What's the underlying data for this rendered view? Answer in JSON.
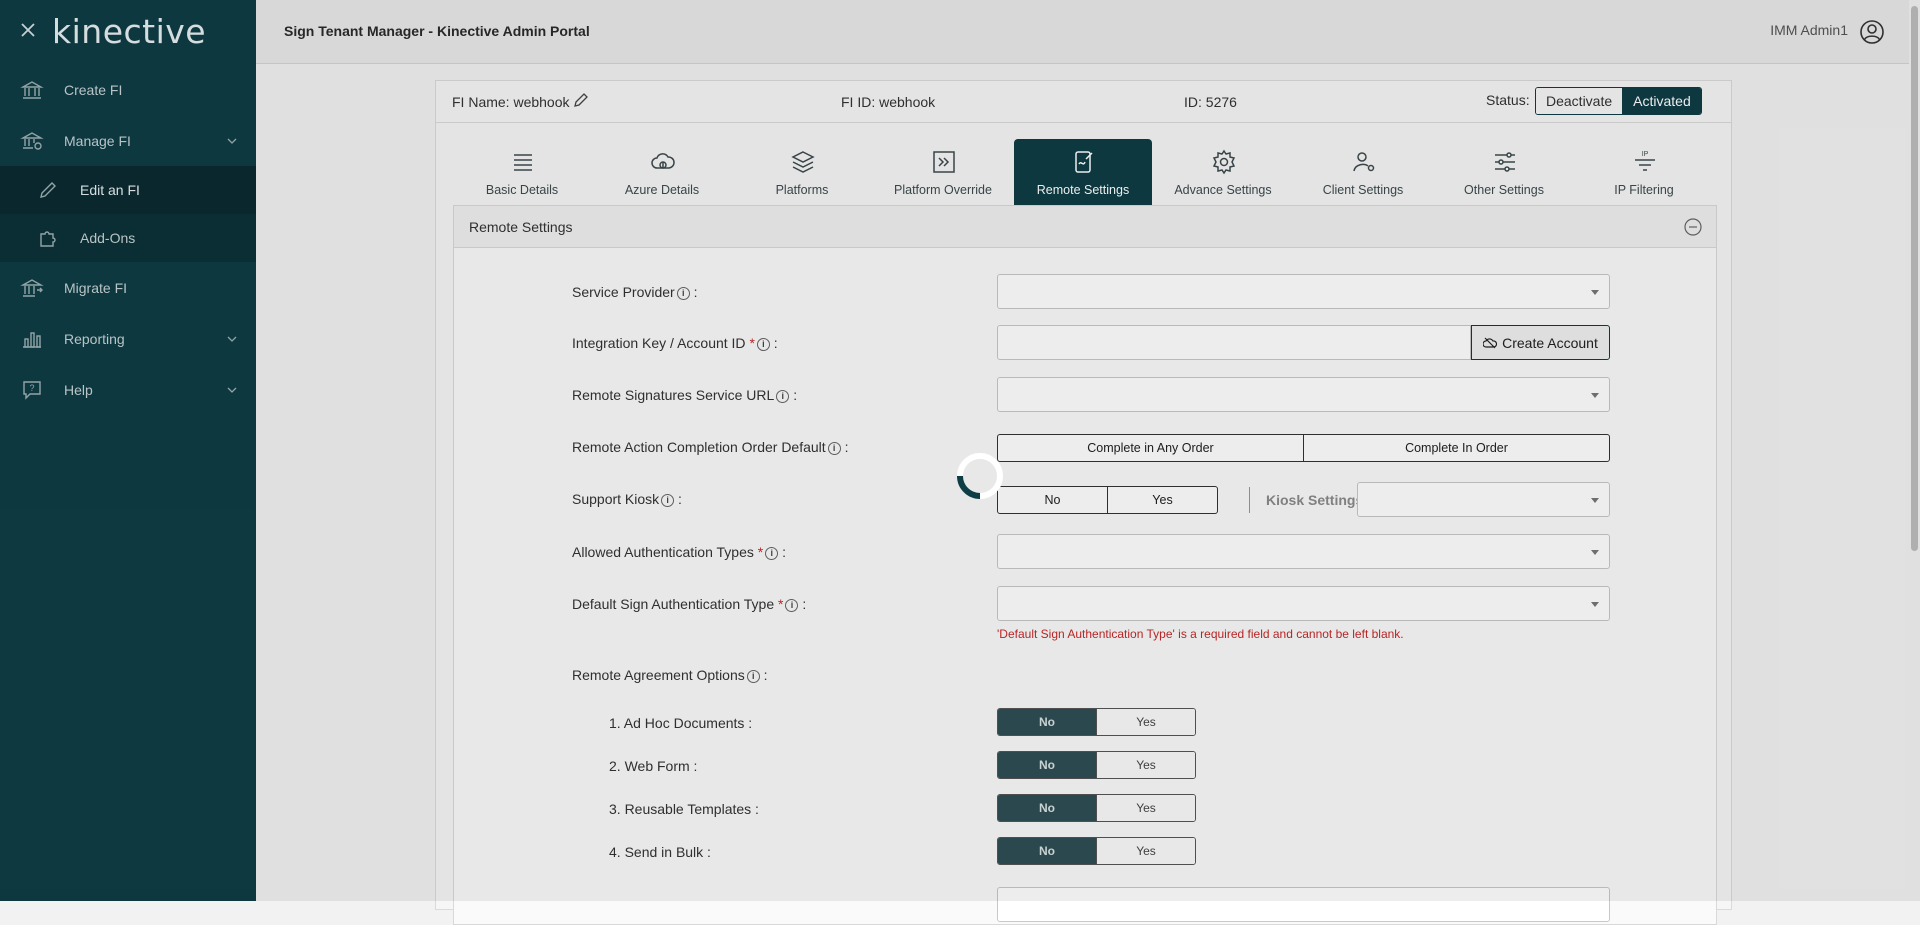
{
  "sidebar": {
    "logo": "kinective",
    "items": [
      {
        "label": "Create FI",
        "icon": "bank-icon"
      },
      {
        "label": "Manage FI",
        "icon": "bank-gear-icon"
      },
      {
        "label": "Edit an FI",
        "icon": "pencil-icon"
      },
      {
        "label": "Add-Ons",
        "icon": "puzzle-icon"
      },
      {
        "label": "Migrate FI",
        "icon": "bank-arrow-icon"
      },
      {
        "label": "Reporting",
        "icon": "bar-chart-icon"
      },
      {
        "label": "Help",
        "icon": "help-bubble-icon"
      }
    ]
  },
  "header": {
    "title": "Sign Tenant Manager - Kinective Admin Portal",
    "user": "IMM Admin1"
  },
  "fi": {
    "name": "FI Name: webhook",
    "fi_id": "FI ID: webhook",
    "id": "ID: 5276",
    "status_label": "Status:",
    "deactivate": "Deactivate",
    "activated": "Activated"
  },
  "tabs": [
    {
      "label": "Basic Details",
      "icon": "list-icon"
    },
    {
      "label": "Azure Details",
      "icon": "cloud-icon"
    },
    {
      "label": "Platforms",
      "icon": "layers-icon"
    },
    {
      "label": "Platform Override",
      "icon": "override-icon"
    },
    {
      "label": "Remote Settings",
      "icon": "remote-sign-icon"
    },
    {
      "label": "Advance Settings",
      "icon": "gear-icon"
    },
    {
      "label": "Client Settings",
      "icon": "user-gear-icon"
    },
    {
      "label": "Other Settings",
      "icon": "sliders-icon"
    },
    {
      "label": "IP Filtering",
      "icon": "ip-filter-icon"
    }
  ],
  "section": {
    "title": "Remote Settings",
    "fields": {
      "service_provider": "Service Provider",
      "integration_key": "Integration Key / Account ID",
      "create_account": "Create Account",
      "remote_url": "Remote Signatures Service URL",
      "completion_order": "Remote Action Completion Order Default",
      "complete_any": "Complete in Any Order",
      "complete_in": "Complete In Order",
      "support_kiosk": "Support Kiosk",
      "no": "No",
      "yes": "Yes",
      "kiosk_settings": "Kiosk Settings:",
      "allowed_auth": "Allowed Authentication Types",
      "default_auth": "Default Sign Authentication Type",
      "error": "'Default Sign Authentication Type' is a required field and cannot be left blank.",
      "agreement_options": "Remote Agreement Options",
      "options": [
        "1. Ad Hoc Documents :",
        "2. Web Form :",
        "3. Reusable Templates :",
        "4. Send in Bulk :"
      ]
    }
  },
  "colors": {
    "sidebar": "#0f3d45",
    "accent": "#0f3d45",
    "error": "#c62828"
  }
}
